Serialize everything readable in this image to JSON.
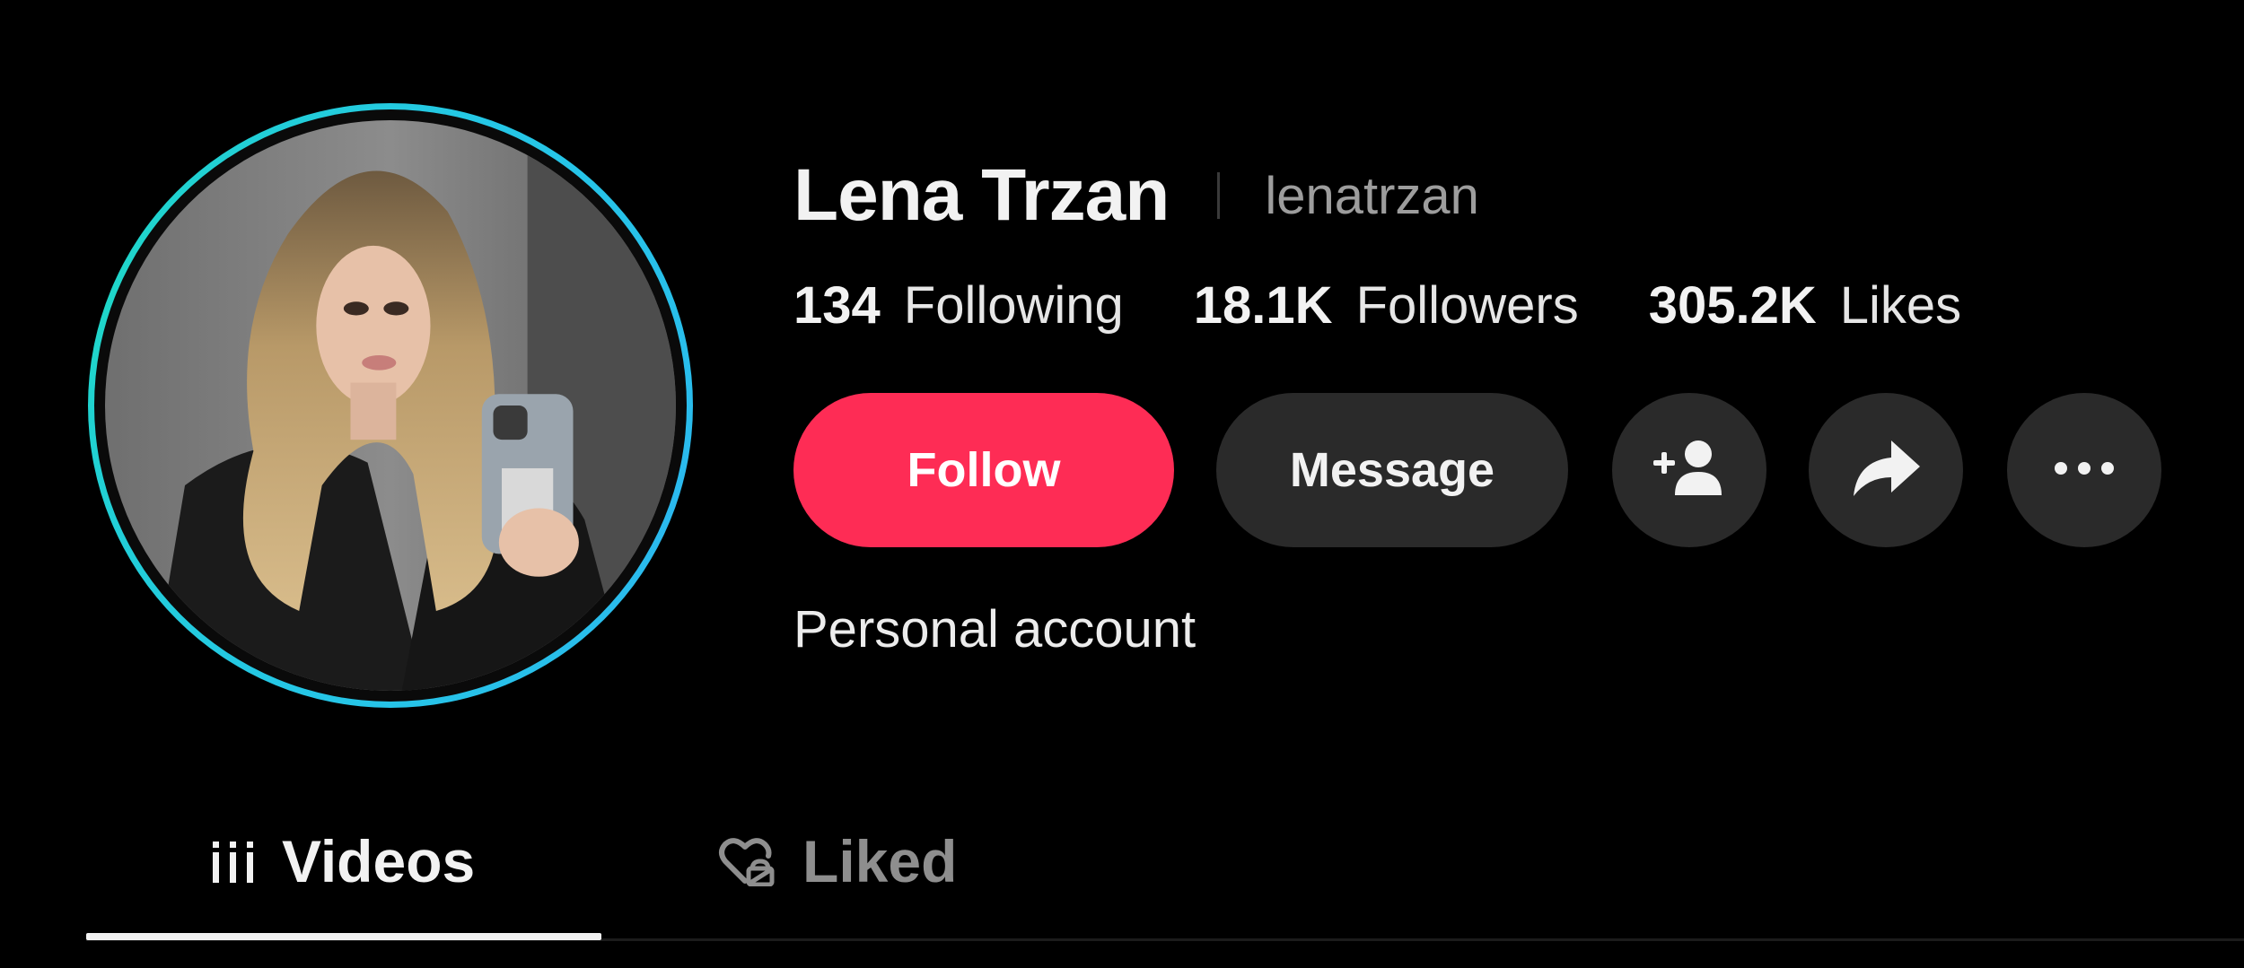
{
  "profile": {
    "display_name": "Lena Trzan",
    "username": "lenatrzan",
    "bio": "Personal account",
    "avatar_icon": "profile-photo"
  },
  "stats": {
    "following_count": "134",
    "following_label": "Following",
    "followers_count": "18.1K",
    "followers_label": "Followers",
    "likes_count": "305.2K",
    "likes_label": "Likes"
  },
  "actions": {
    "follow_label": "Follow",
    "message_label": "Message",
    "add_friend_icon": "add-user-icon",
    "share_icon": "share-arrow-icon",
    "more_icon": "more-dots-icon"
  },
  "tabs": [
    {
      "label": "Videos",
      "icon": "grid-icon",
      "active": true
    },
    {
      "label": "Liked",
      "icon": "heart-lock-icon",
      "active": false
    }
  ],
  "colors": {
    "background": "#000000",
    "follow_button": "#fe2c55",
    "secondary_button": "#2a2a2a",
    "avatar_ring": "#25c7e6",
    "active_tab": "#f2f2f2",
    "inactive_tab": "#8e8e8e"
  }
}
